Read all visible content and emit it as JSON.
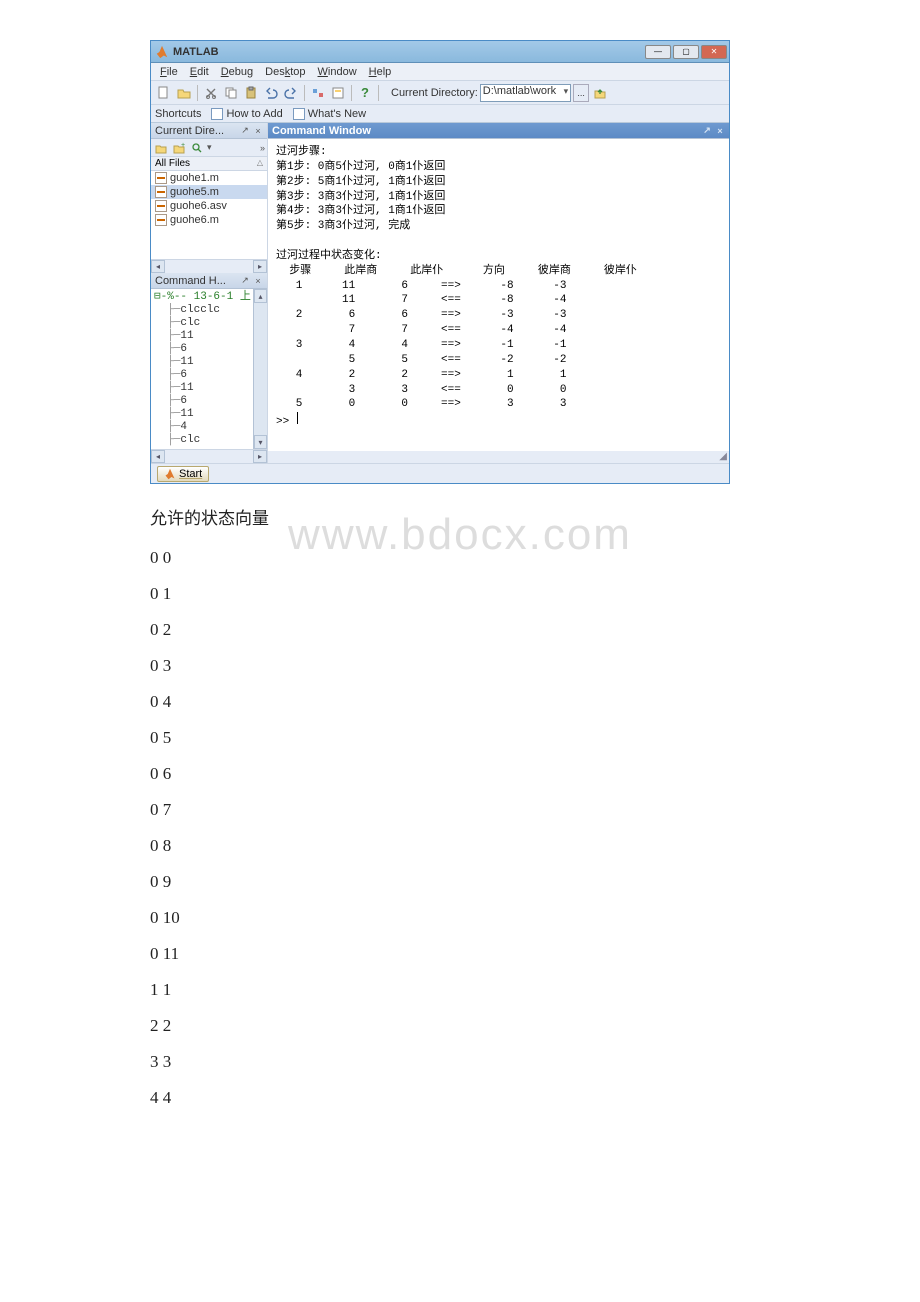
{
  "window": {
    "title": "MATLAB",
    "buttons": {
      "min": "—",
      "max": "▢",
      "close": "✕"
    }
  },
  "menu": {
    "file": "File",
    "edit": "Edit",
    "debug": "Debug",
    "desktop": "Desktop",
    "window": "Window",
    "help": "Help"
  },
  "toolbar": {
    "dir_label": "Current Directory:",
    "dir_value": "D:\\matlab\\work",
    "browse": "...",
    "icons": {
      "new": "new-file-icon",
      "open": "open-folder-icon",
      "cut": "cut-icon",
      "copy": "copy-icon",
      "paste": "paste-icon",
      "undo": "undo-icon",
      "redo": "redo-icon",
      "simulink": "simulink-icon",
      "guide": "guide-icon",
      "help": "help-icon",
      "up": "up-folder-icon"
    }
  },
  "shortcuts": {
    "label": "Shortcuts",
    "items": [
      "How to Add",
      "What's New"
    ]
  },
  "current_dir": {
    "title": "Current Dire...",
    "header": "All Files",
    "files": [
      {
        "name": "guohe1.m",
        "selected": false
      },
      {
        "name": "guohe5.m",
        "selected": true
      },
      {
        "name": "guohe6.asv",
        "selected": false
      },
      {
        "name": "guohe6.m",
        "selected": false
      }
    ]
  },
  "command_history": {
    "title": "Command H...",
    "root": "%-- 13-6-1 上",
    "items": [
      "clcclc",
      "clc",
      "11",
      "6",
      "11",
      "6",
      "11",
      "6",
      "11",
      "4",
      "clc"
    ]
  },
  "command_window": {
    "title": "Command Window",
    "intro_lines": [
      "过河步骤:",
      "第1步: 0商5仆过河, 0商1仆返回",
      "第2步: 5商1仆过河, 1商1仆返回",
      "第3步: 3商3仆过河, 1商1仆返回",
      "第4步: 3商3仆过河, 1商1仆返回",
      "第5步: 3商3仆过河, 完成"
    ],
    "table_title": "过河过程中状态变化:",
    "table_header": [
      "步骤",
      "此岸商",
      "此岸仆",
      "方向",
      "彼岸商",
      "彼岸仆"
    ],
    "rows": [
      [
        "1",
        "11",
        "6",
        "==>",
        "-8",
        "-3"
      ],
      [
        "",
        "11",
        "7",
        "<==",
        "-8",
        "-4"
      ],
      [
        "2",
        "6",
        "6",
        "==>",
        "-3",
        "-3"
      ],
      [
        "",
        "7",
        "7",
        "<==",
        "-4",
        "-4"
      ],
      [
        "3",
        "4",
        "4",
        "==>",
        "-1",
        "-1"
      ],
      [
        "",
        "5",
        "5",
        "<==",
        "-2",
        "-2"
      ],
      [
        "4",
        "2",
        "2",
        "==>",
        "1",
        "1"
      ],
      [
        "",
        "3",
        "3",
        "<==",
        "0",
        "0"
      ],
      [
        "5",
        "0",
        "0",
        "==>",
        "3",
        "3"
      ]
    ],
    "prompt": ">> "
  },
  "statusbar": {
    "start": "Start"
  },
  "document": {
    "heading": "允许的状态向量",
    "vectors": [
      "0 0",
      "0 1",
      "0 2",
      "0 3",
      "0 4",
      "0 5",
      "0 6",
      "0 7",
      "0 8",
      "0 9",
      "0 10",
      "0 11",
      "1 1",
      "2 2",
      "3 3",
      "4 4"
    ],
    "watermark": "www.bdocx.com"
  }
}
